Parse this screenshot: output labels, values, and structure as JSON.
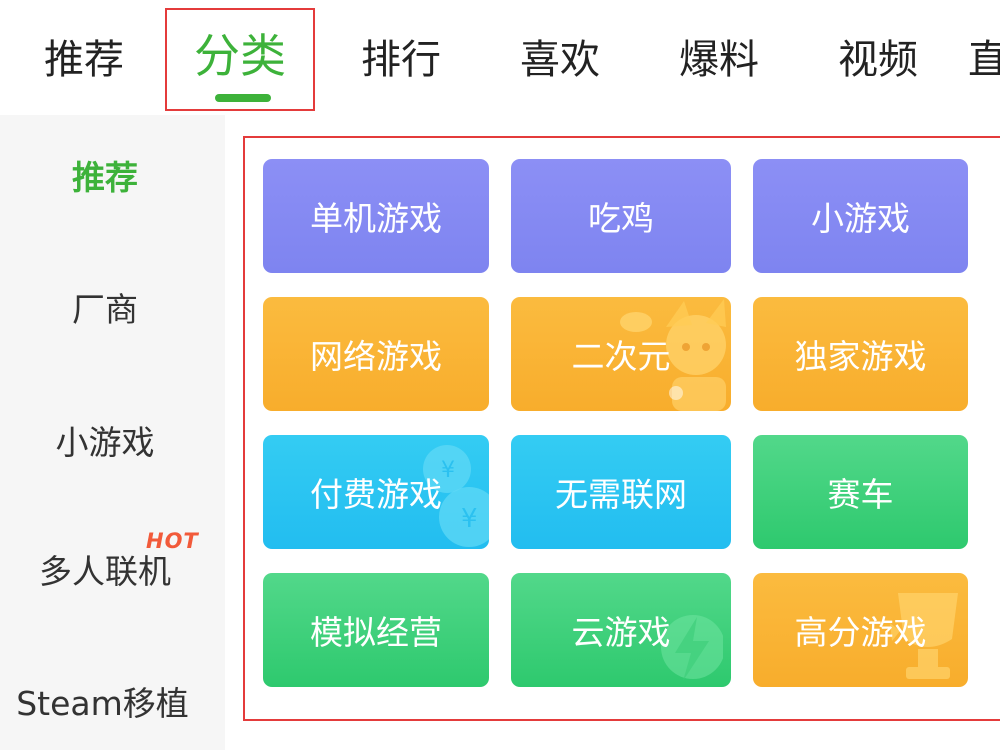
{
  "tabs": [
    {
      "label": "推荐",
      "active": false
    },
    {
      "label": "分类",
      "active": true
    },
    {
      "label": "排行",
      "active": false
    },
    {
      "label": "喜欢",
      "active": false
    },
    {
      "label": "爆料",
      "active": false
    },
    {
      "label": "视频",
      "active": false
    },
    {
      "label": "直",
      "active": false
    }
  ],
  "sidebar": {
    "items": [
      {
        "label": "推荐",
        "active": true
      },
      {
        "label": "厂商",
        "active": false
      },
      {
        "label": "小游戏",
        "active": false
      },
      {
        "label": "多人联机",
        "active": false,
        "badge": "HOT"
      },
      {
        "label": "Steam移植",
        "active": false
      }
    ]
  },
  "categories": [
    {
      "label": "单机游戏",
      "color": "purple"
    },
    {
      "label": "吃鸡",
      "color": "purple"
    },
    {
      "label": "小游戏",
      "color": "purple"
    },
    {
      "label": "网络游戏",
      "color": "orange"
    },
    {
      "label": "二次元",
      "color": "orange"
    },
    {
      "label": "独家游戏",
      "color": "orange"
    },
    {
      "label": "付费游戏",
      "color": "blue"
    },
    {
      "label": "无需联网",
      "color": "blue"
    },
    {
      "label": "赛车",
      "color": "green"
    },
    {
      "label": "模拟经营",
      "color": "green"
    },
    {
      "label": "云游戏",
      "color": "green"
    },
    {
      "label": "高分游戏",
      "color": "orange"
    }
  ],
  "colors": {
    "accent_green": "#3db23a",
    "highlight_red": "#e43b3b",
    "hot_red": "#f25a3a",
    "tile_purple": "#8489f3",
    "tile_orange": "#f9b434",
    "tile_blue": "#2bc5f1",
    "tile_green": "#3fd07c"
  }
}
